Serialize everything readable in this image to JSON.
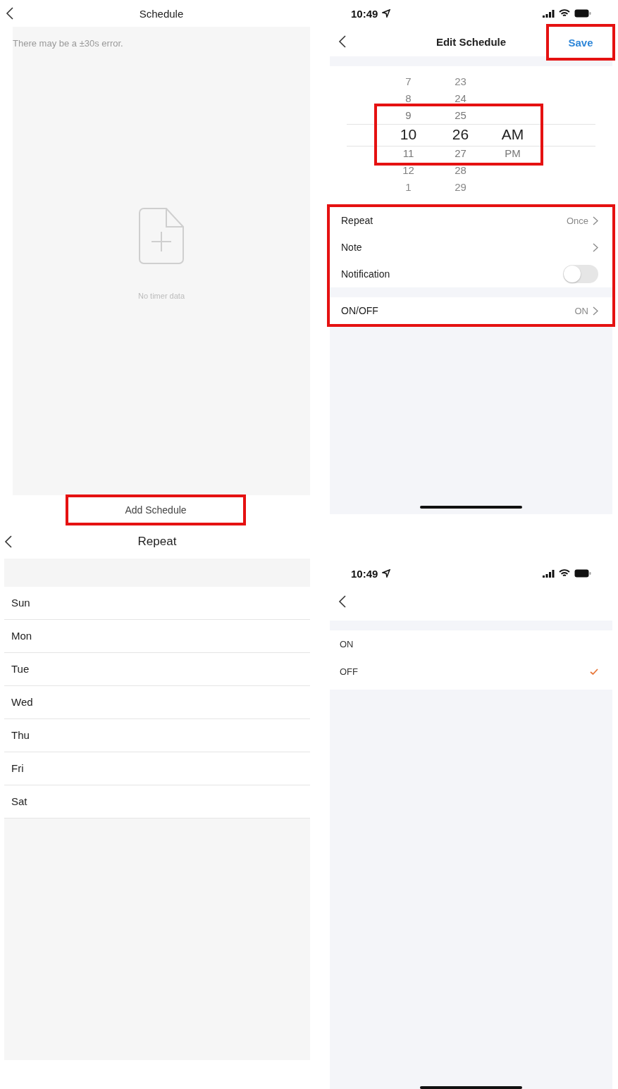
{
  "schedule_screen": {
    "title": "Schedule",
    "hint": "There may be a ±30s error.",
    "empty_text": "No timer data",
    "add_button": {
      "label": "Add Schedule",
      "highlighted": true
    }
  },
  "edit_screen": {
    "status_time": "10:49",
    "title": "Edit Schedule",
    "save_button": {
      "label": "Save",
      "highlighted": true
    },
    "picker": {
      "highlighted": true,
      "columns": [
        {
          "items": [
            {
              "label": "7",
              "selected": false
            },
            {
              "label": "8",
              "selected": false
            },
            {
              "label": "9",
              "selected": false
            },
            {
              "label": "10",
              "selected": true
            },
            {
              "label": "11",
              "selected": false
            },
            {
              "label": "12",
              "selected": false
            },
            {
              "label": "1",
              "selected": false
            }
          ]
        },
        {
          "items": [
            {
              "label": "23",
              "selected": false
            },
            {
              "label": "24",
              "selected": false
            },
            {
              "label": "25",
              "selected": false
            },
            {
              "label": "26",
              "selected": true
            },
            {
              "label": "27",
              "selected": false
            },
            {
              "label": "28",
              "selected": false
            },
            {
              "label": "29",
              "selected": false
            }
          ]
        },
        {
          "items": [
            {
              "label": "AM",
              "selected": true
            },
            {
              "label": "PM",
              "selected": false
            }
          ]
        }
      ]
    },
    "settings": {
      "highlighted": true,
      "groups": [
        {
          "rows": [
            {
              "kind": "link",
              "label": "Repeat",
              "value": "Once"
            },
            {
              "kind": "link",
              "label": "Note"
            },
            {
              "kind": "toggle",
              "label": "Notification",
              "on": false
            }
          ]
        },
        {
          "rows": [
            {
              "kind": "link",
              "label": "ON/OFF",
              "value": "ON"
            }
          ]
        }
      ]
    }
  },
  "repeat_screen": {
    "title": "Repeat",
    "days": [
      {
        "label": "Sun"
      },
      {
        "label": "Mon"
      },
      {
        "label": "Tue"
      },
      {
        "label": "Wed"
      },
      {
        "label": "Thu"
      },
      {
        "label": "Fri"
      },
      {
        "label": "Sat"
      }
    ]
  },
  "onoff_screen": {
    "status_time": "10:49",
    "options": [
      {
        "label": "ON",
        "selected": false
      },
      {
        "label": "OFF",
        "selected": true
      }
    ]
  }
}
